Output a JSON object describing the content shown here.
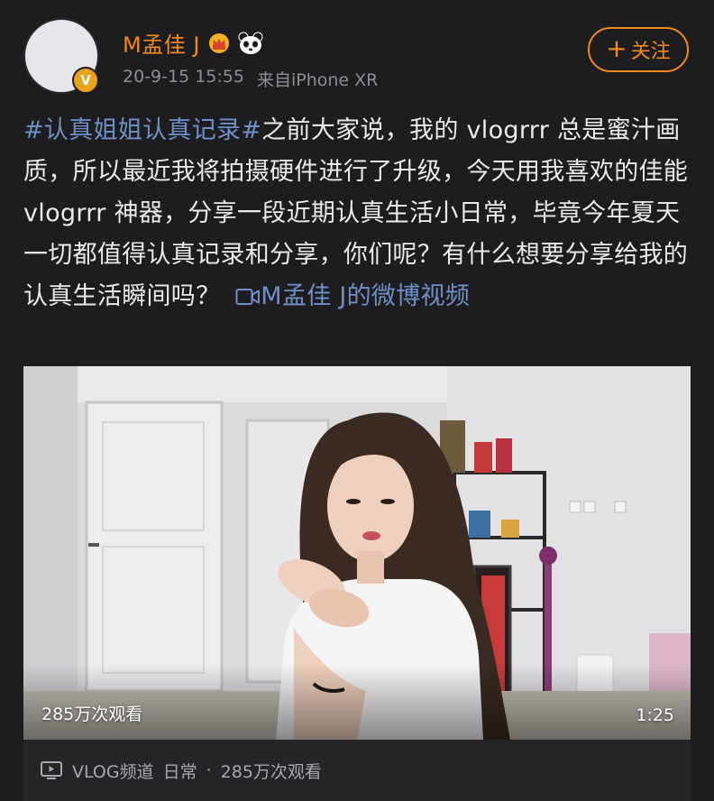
{
  "user": {
    "name": "M孟佳 J",
    "verified_badge": "V",
    "timestamp": "20-9-15 15:55",
    "source": "来自iPhone XR",
    "badges": [
      "crown-icon",
      "panda-icon"
    ]
  },
  "follow_button": {
    "label": "关注"
  },
  "post": {
    "hashtag": "#认真姐姐认真记录#",
    "text": "之前大家说，我的 vlogrrr 总是蜜汁画质，所以最近我将拍摄硬件进行了升级，今天用我喜欢的佳能 vlogrrr 神器，分享一段近期认真生活小日常，毕竟今年夏天一切都值得认真记录和分享，你们呢？有什么想要分享给我的认真生活瞬间吗？",
    "video_link": "M孟佳 J的微博视频"
  },
  "video": {
    "views_overlay": "285万次观看",
    "duration": "1:25"
  },
  "video_footer": {
    "channel": "VLOG频道",
    "category": "日常",
    "separator": "·",
    "views": "285万次观看"
  },
  "colors": {
    "background": "#1d1d1f",
    "accent": "#f08a1c",
    "link": "#6f8fc8",
    "meta": "#8e8e93"
  }
}
